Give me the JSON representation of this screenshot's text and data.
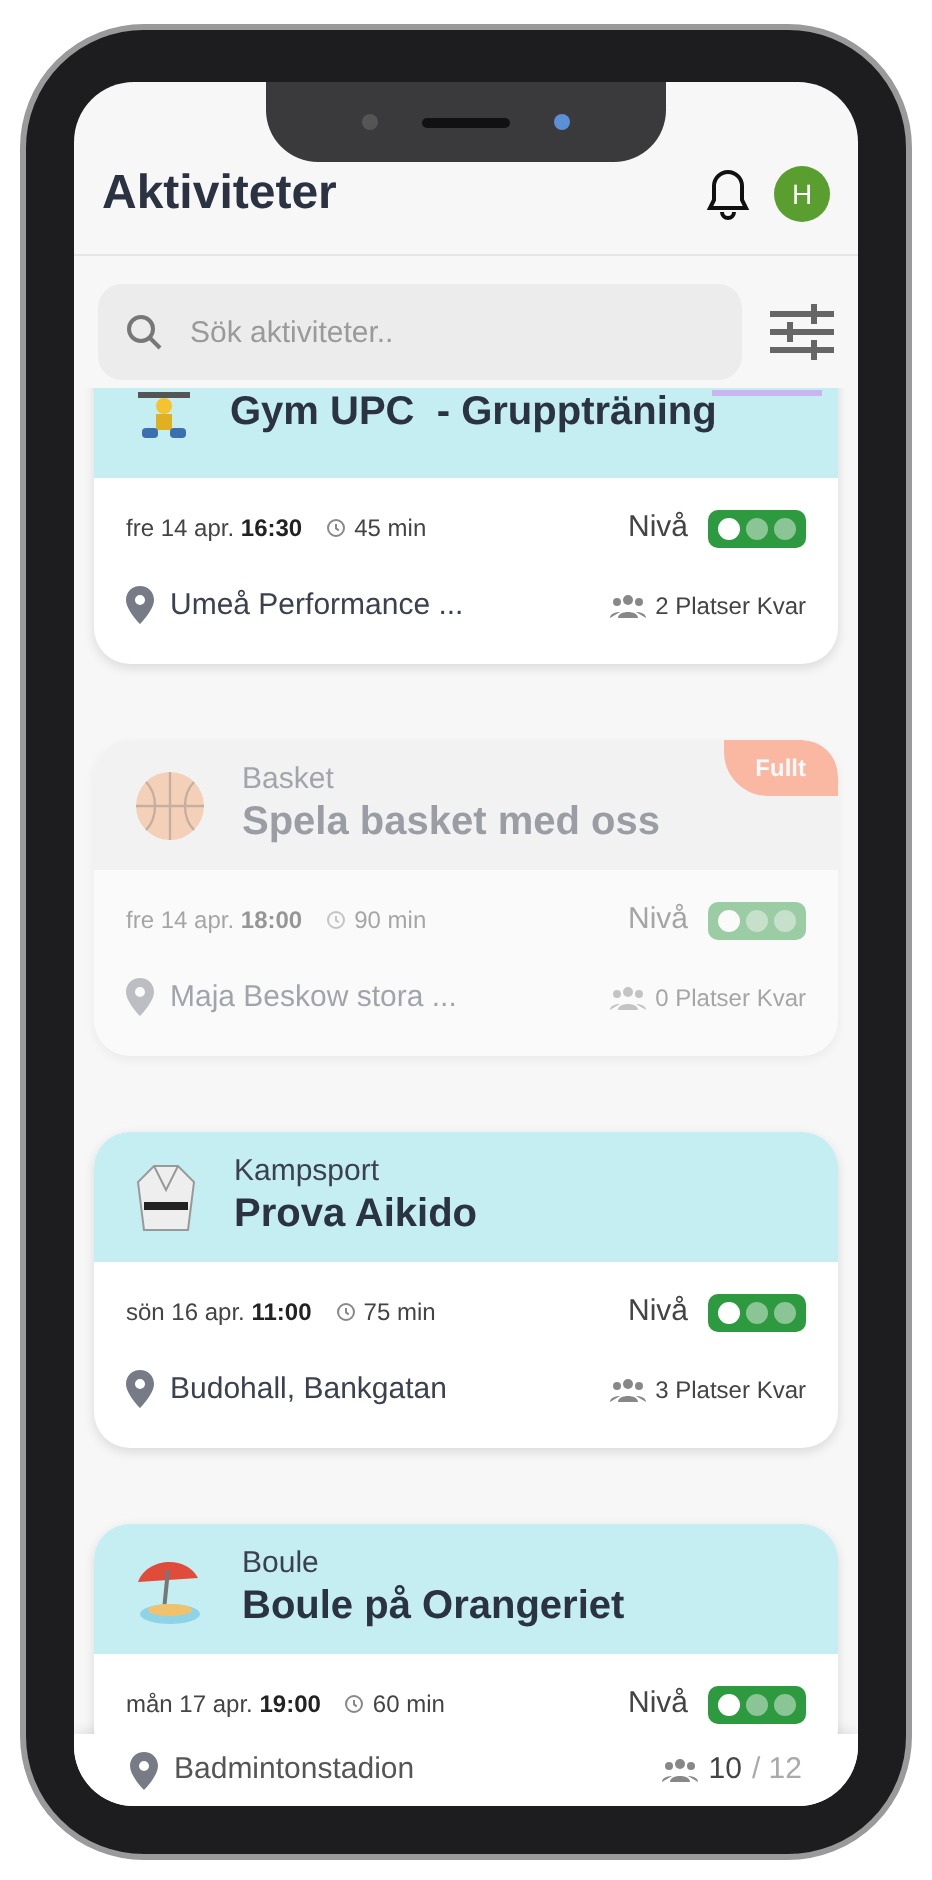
{
  "header": {
    "title": "Aktiviteter",
    "avatar": "H"
  },
  "search": {
    "placeholder": "Sök aktiviteter.."
  },
  "activities": [
    {
      "kind": "weights",
      "title": "Gym UPC  - Gruppträning",
      "color": "#c9b6f0",
      "full": false,
      "date": "fre 14 apr.",
      "time": "16:30",
      "duration": "45 min",
      "level_label": "Nivå",
      "level_dots": [
        true,
        false,
        false
      ],
      "location": "Umeå Performance ...",
      "spots": "2 Platser Kvar"
    },
    {
      "kind": "ball",
      "category": "Basket",
      "title": "Spela basket med oss",
      "badge": "Fullt",
      "full": true,
      "date": "fre 14 apr.",
      "time": "18:00",
      "duration": "90 min",
      "level_label": "Nivå",
      "level_dots": [
        true,
        false,
        false
      ],
      "location": "Maja Beskow stora ...",
      "spots": "0 Platser Kvar"
    },
    {
      "kind": "gi",
      "category": "Kampsport",
      "title": "Prova Aikido",
      "full": false,
      "date": "sön 16 apr.",
      "time": "11:00",
      "duration": "75 min",
      "level_label": "Nivå",
      "level_dots": [
        true,
        false,
        false
      ],
      "location": "Budohall, Bankgatan",
      "spots": "3 Platser Kvar"
    },
    {
      "kind": "beach",
      "category": "Boule",
      "title": "Boule på Orangeriet",
      "full": false,
      "date": "mån 17 apr.",
      "time": "19:00",
      "duration": "60 min",
      "level_label": "Nivå",
      "level_dots": [
        true,
        false,
        false
      ]
    }
  ],
  "bottom_bar": {
    "location": "Badmintonstadion",
    "count": "10",
    "total": "/ 12"
  }
}
